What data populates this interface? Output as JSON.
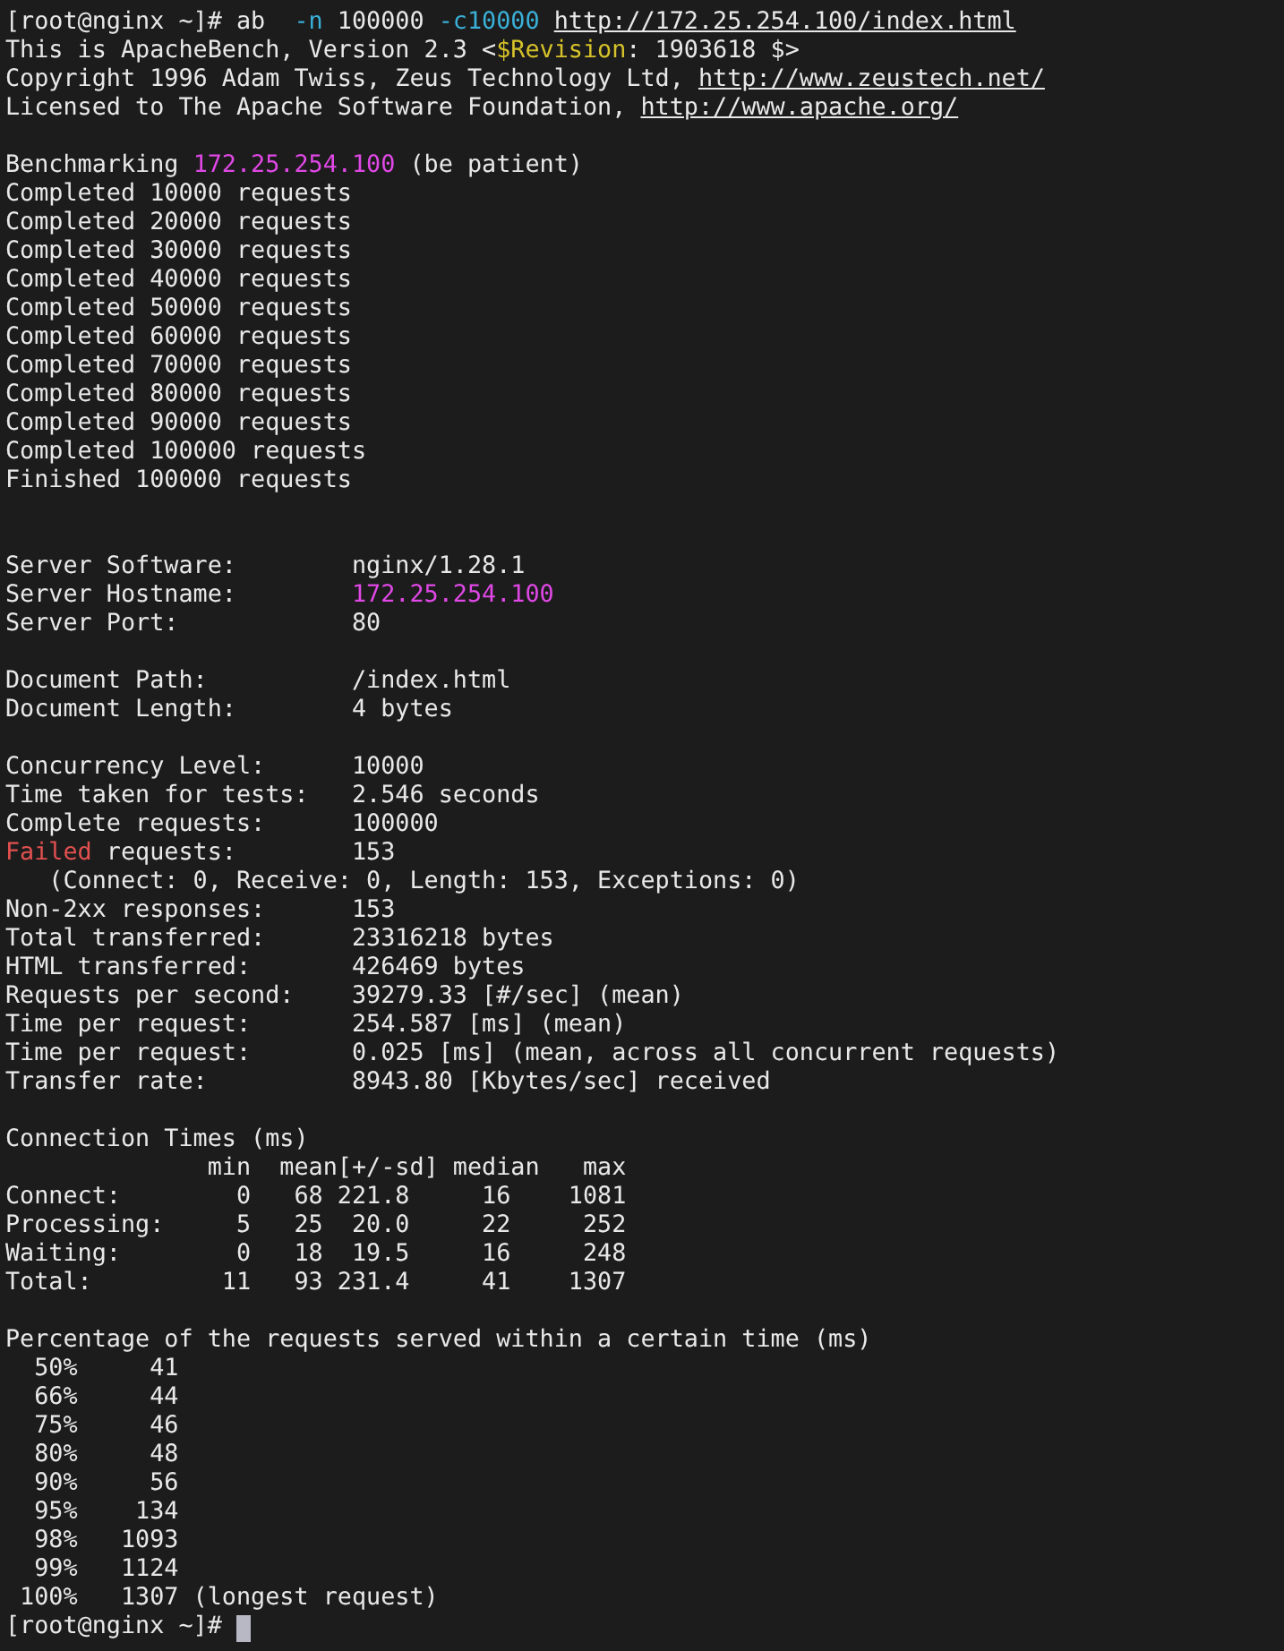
{
  "terminal": {
    "lines": [
      {
        "kind": "text",
        "segments": [
          {
            "kind": "plain",
            "text": "[root@nginx ~]# ab  "
          },
          {
            "kind": "option",
            "text": "-n"
          },
          {
            "kind": "plain",
            "text": " 100000 "
          },
          {
            "kind": "option",
            "text": "-c10000"
          },
          {
            "kind": "link",
            "gap": true,
            "text": "http://172.25.254.100/index.html"
          }
        ]
      },
      {
        "kind": "text",
        "segments": [
          {
            "kind": "plain",
            "text": "This is ApacheBench, Version 2.3 <"
          },
          {
            "kind": "keyword",
            "text": "$Revision"
          },
          {
            "kind": "plain",
            "text": ": 1903618 $>"
          }
        ]
      },
      {
        "kind": "text",
        "segments": [
          {
            "kind": "plain",
            "text": "Copyright 1996 Adam Twiss, Zeus Technology Ltd, "
          },
          {
            "kind": "link",
            "text": "http://www.zeustech.net/"
          }
        ]
      },
      {
        "kind": "text",
        "segments": [
          {
            "kind": "plain",
            "text": "Licensed to The Apache Software Foundation, "
          },
          {
            "kind": "link",
            "text": "http://www.apache.org/"
          }
        ]
      },
      {
        "kind": "blank"
      },
      {
        "kind": "text",
        "segments": [
          {
            "kind": "plain",
            "text": "Benchmarking "
          },
          {
            "kind": "ip",
            "text": "172.25.254.100"
          },
          {
            "kind": "plain",
            "text": " (be patient)"
          }
        ]
      },
      {
        "kind": "text",
        "segments": [
          {
            "kind": "plain",
            "text": "Completed 10000 requests"
          }
        ]
      },
      {
        "kind": "text",
        "segments": [
          {
            "kind": "plain",
            "text": "Completed 20000 requests"
          }
        ]
      },
      {
        "kind": "text",
        "segments": [
          {
            "kind": "plain",
            "text": "Completed 30000 requests"
          }
        ]
      },
      {
        "kind": "text",
        "segments": [
          {
            "kind": "plain",
            "text": "Completed 40000 requests"
          }
        ]
      },
      {
        "kind": "text",
        "segments": [
          {
            "kind": "plain",
            "text": "Completed 50000 requests"
          }
        ]
      },
      {
        "kind": "text",
        "segments": [
          {
            "kind": "plain",
            "text": "Completed 60000 requests"
          }
        ]
      },
      {
        "kind": "text",
        "segments": [
          {
            "kind": "plain",
            "text": "Completed 70000 requests"
          }
        ]
      },
      {
        "kind": "text",
        "segments": [
          {
            "kind": "plain",
            "text": "Completed 80000 requests"
          }
        ]
      },
      {
        "kind": "text",
        "segments": [
          {
            "kind": "plain",
            "text": "Completed 90000 requests"
          }
        ]
      },
      {
        "kind": "text",
        "segments": [
          {
            "kind": "plain",
            "text": "Completed 100000 requests"
          }
        ]
      },
      {
        "kind": "text",
        "segments": [
          {
            "kind": "plain",
            "text": "Finished 100000 requests"
          }
        ]
      },
      {
        "kind": "blank"
      },
      {
        "kind": "blank"
      },
      {
        "kind": "text",
        "segments": [
          {
            "kind": "plain",
            "text": "Server Software:        nginx/1.28.1"
          }
        ]
      },
      {
        "kind": "text",
        "segments": [
          {
            "kind": "plain",
            "text": "Server Hostname:        "
          },
          {
            "kind": "ip",
            "text": "172.25.254.100"
          }
        ]
      },
      {
        "kind": "text",
        "segments": [
          {
            "kind": "plain",
            "text": "Server Port:            80"
          }
        ]
      },
      {
        "kind": "blank"
      },
      {
        "kind": "text",
        "segments": [
          {
            "kind": "plain",
            "text": "Document Path:          /index.html"
          }
        ]
      },
      {
        "kind": "text",
        "segments": [
          {
            "kind": "plain",
            "text": "Document Length:        4 bytes"
          }
        ]
      },
      {
        "kind": "blank"
      },
      {
        "kind": "text",
        "segments": [
          {
            "kind": "plain",
            "text": "Concurrency Level:      10000"
          }
        ]
      },
      {
        "kind": "text",
        "segments": [
          {
            "kind": "plain",
            "text": "Time taken for tests:   2.546 seconds"
          }
        ]
      },
      {
        "kind": "text",
        "segments": [
          {
            "kind": "plain",
            "text": "Complete requests:      100000"
          }
        ]
      },
      {
        "kind": "text",
        "segments": [
          {
            "kind": "error",
            "text": "Failed"
          },
          {
            "kind": "plain",
            "text": " requests:        153"
          }
        ]
      },
      {
        "kind": "text",
        "segments": [
          {
            "kind": "plain",
            "text": "   (Connect: 0, Receive: 0, Length: 153, Exceptions: 0)"
          }
        ]
      },
      {
        "kind": "text",
        "segments": [
          {
            "kind": "plain",
            "text": "Non-2xx responses:      153"
          }
        ]
      },
      {
        "kind": "text",
        "segments": [
          {
            "kind": "plain",
            "text": "Total transferred:      23316218 bytes"
          }
        ]
      },
      {
        "kind": "text",
        "segments": [
          {
            "kind": "plain",
            "text": "HTML transferred:       426469 bytes"
          }
        ]
      },
      {
        "kind": "text",
        "segments": [
          {
            "kind": "plain",
            "text": "Requests per second:    39279.33 [#/sec] (mean)"
          }
        ]
      },
      {
        "kind": "text",
        "segments": [
          {
            "kind": "plain",
            "text": "Time per request:       254.587 [ms] (mean)"
          }
        ]
      },
      {
        "kind": "text",
        "segments": [
          {
            "kind": "plain",
            "text": "Time per request:       0.025 [ms] (mean, across all concurrent requests)"
          }
        ]
      },
      {
        "kind": "text",
        "segments": [
          {
            "kind": "plain",
            "text": "Transfer rate:          8943.80 [Kbytes/sec] received"
          }
        ]
      },
      {
        "kind": "blank"
      },
      {
        "kind": "text",
        "segments": [
          {
            "kind": "plain",
            "text": "Connection Times (ms)"
          }
        ]
      },
      {
        "kind": "text",
        "segments": [
          {
            "kind": "plain",
            "text": "              min  mean[+/-sd] median   max"
          }
        ]
      },
      {
        "kind": "text",
        "segments": [
          {
            "kind": "plain",
            "text": "Connect:        0   68 221.8     16    1081"
          }
        ]
      },
      {
        "kind": "text",
        "segments": [
          {
            "kind": "plain",
            "text": "Processing:     5   25  20.0     22     252"
          }
        ]
      },
      {
        "kind": "text",
        "segments": [
          {
            "kind": "plain",
            "text": "Waiting:        0   18  19.5     16     248"
          }
        ]
      },
      {
        "kind": "text",
        "segments": [
          {
            "kind": "plain",
            "text": "Total:         11   93 231.4     41    1307"
          }
        ]
      },
      {
        "kind": "blank"
      },
      {
        "kind": "text",
        "segments": [
          {
            "kind": "plain",
            "text": "Percentage of the requests served within a certain time (ms)"
          }
        ]
      },
      {
        "kind": "text",
        "segments": [
          {
            "kind": "plain",
            "text": "  50%     41"
          }
        ]
      },
      {
        "kind": "text",
        "segments": [
          {
            "kind": "plain",
            "text": "  66%     44"
          }
        ]
      },
      {
        "kind": "text",
        "segments": [
          {
            "kind": "plain",
            "text": "  75%     46"
          }
        ]
      },
      {
        "kind": "text",
        "segments": [
          {
            "kind": "plain",
            "text": "  80%     48"
          }
        ]
      },
      {
        "kind": "text",
        "segments": [
          {
            "kind": "plain",
            "text": "  90%     56"
          }
        ]
      },
      {
        "kind": "text",
        "segments": [
          {
            "kind": "plain",
            "text": "  95%    134"
          }
        ]
      },
      {
        "kind": "text",
        "segments": [
          {
            "kind": "plain",
            "text": "  98%   1093"
          }
        ]
      },
      {
        "kind": "text",
        "segments": [
          {
            "kind": "plain",
            "text": "  99%   1124"
          }
        ]
      },
      {
        "kind": "text",
        "segments": [
          {
            "kind": "plain",
            "text": " 100%   1307 (longest request)"
          }
        ]
      },
      {
        "kind": "text",
        "cursor": true,
        "segments": [
          {
            "kind": "plain",
            "text": "[root@nginx ~]# "
          }
        ]
      }
    ]
  }
}
